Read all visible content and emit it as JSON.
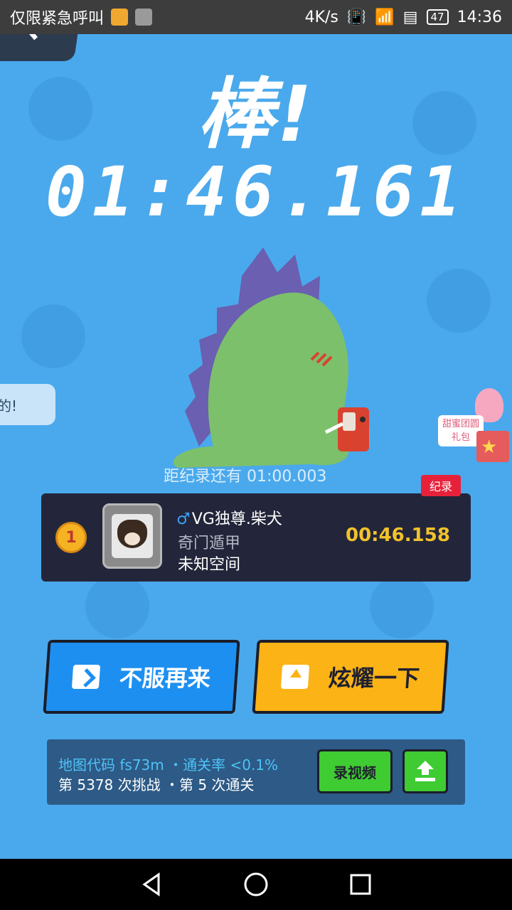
{
  "status_bar": {
    "carrier_text": "仅限紧急呼叫",
    "network_speed": "4K/s",
    "battery": "47",
    "time": "14:36"
  },
  "game": {
    "title": "棒!",
    "timer": "01:46.161",
    "toast_text": "的!",
    "dino_caption": "距纪录还有 01:00.003",
    "gift_text": "甜蜜团圆礼包"
  },
  "record": {
    "tag": "纪录",
    "rank": "1",
    "player_gender_symbol": "♂",
    "player_name": "VG独尊.柴犬",
    "subtitle_1": "奇门遁甲",
    "subtitle_2": "未知空间",
    "time": "00:46.158"
  },
  "buttons": {
    "retry": "不服再来",
    "share": "炫耀一下"
  },
  "info": {
    "line1": "地图代码 fs73m ・通关率 <0.1%",
    "line2": "第 5378 次挑战 ・第 5 次通关",
    "record_video": "录视频"
  },
  "colors": {
    "background": "#4aa9ec",
    "retry_button": "#1d8ff0",
    "share_button": "#fbb315",
    "record_time": "#f2c22b",
    "record_tag": "#e8213b",
    "dino_body": "#7cc06b",
    "dino_spikes": "#6a5fb0"
  }
}
